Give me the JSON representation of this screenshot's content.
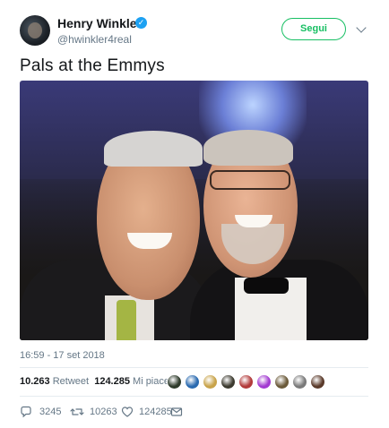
{
  "user": {
    "name": "Henry Winkler",
    "handle": "@hwinkler4real",
    "verified_mark": "✓"
  },
  "follow": {
    "label": "Segui"
  },
  "tweet": {
    "text": "Pals at the Emmys",
    "timestamp": "16:59 - 17 set 2018"
  },
  "stats": {
    "retweet_count": "10.263",
    "retweet_label": "Retweet",
    "like_count": "124.285",
    "like_label": "Mi piace"
  },
  "likers": [
    {
      "color": "#2d3a2a"
    },
    {
      "color": "#2a6ab0"
    },
    {
      "color": "#c8a34a"
    },
    {
      "color": "#3c3a2f"
    },
    {
      "color": "#b23a3a"
    },
    {
      "color": "#a23bd1"
    },
    {
      "color": "#6b5a3a"
    },
    {
      "color": "#7a7a7a"
    },
    {
      "color": "#5a3a2a"
    }
  ],
  "actions": {
    "reply_count": "3245",
    "retweet_count": "10263",
    "like_count": "124285"
  },
  "icons": {
    "verified": "verified-badge-icon",
    "more": "chevron-down-icon",
    "reply": "reply-icon",
    "retweet": "retweet-icon",
    "like": "heart-icon",
    "dm": "envelope-icon"
  }
}
